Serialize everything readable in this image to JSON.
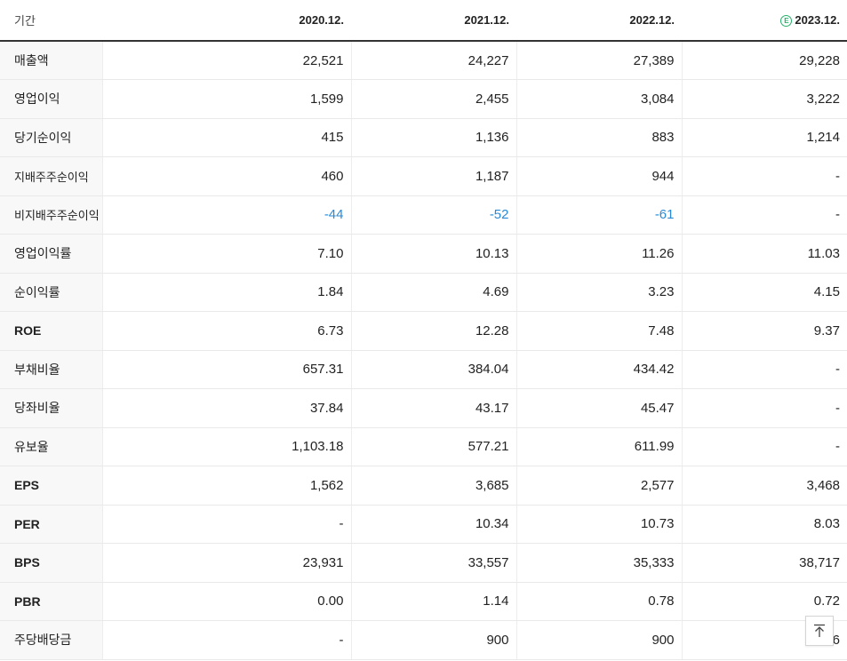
{
  "table": {
    "label_header": "기간",
    "periods": [
      {
        "label": "2020.12.",
        "estimate": false
      },
      {
        "label": "2021.12.",
        "estimate": false
      },
      {
        "label": "2022.12.",
        "estimate": false
      },
      {
        "label": "2023.12.",
        "estimate": true,
        "badge": "E"
      }
    ],
    "rows": [
      {
        "label": "매출액",
        "values": [
          "22,521",
          "24,227",
          "27,389",
          "29,228"
        ],
        "group_start": false,
        "style": "normal"
      },
      {
        "label": "영업이익",
        "values": [
          "1,599",
          "2,455",
          "3,084",
          "3,222"
        ],
        "group_start": false,
        "style": "normal"
      },
      {
        "label": "당기순이익",
        "values": [
          "415",
          "1,136",
          "883",
          "1,214"
        ],
        "group_start": false,
        "style": "normal"
      },
      {
        "label": "지배주주순이익",
        "values": [
          "460",
          "1,187",
          "944",
          "-"
        ],
        "group_start": false,
        "style": "small"
      },
      {
        "label": "비지배주주순이익",
        "values": [
          "-44",
          "-52",
          "-61",
          "-"
        ],
        "group_start": false,
        "style": "small"
      },
      {
        "label": "영업이익률",
        "values": [
          "7.10",
          "10.13",
          "11.26",
          "11.03"
        ],
        "group_start": true,
        "style": "normal"
      },
      {
        "label": "순이익률",
        "values": [
          "1.84",
          "4.69",
          "3.23",
          "4.15"
        ],
        "group_start": false,
        "style": "normal"
      },
      {
        "label": "ROE",
        "values": [
          "6.73",
          "12.28",
          "7.48",
          "9.37"
        ],
        "group_start": false,
        "style": "bold"
      },
      {
        "label": "부채비율",
        "values": [
          "657.31",
          "384.04",
          "434.42",
          "-"
        ],
        "group_start": true,
        "style": "normal"
      },
      {
        "label": "당좌비율",
        "values": [
          "37.84",
          "43.17",
          "45.47",
          "-"
        ],
        "group_start": false,
        "style": "normal"
      },
      {
        "label": "유보율",
        "values": [
          "1,103.18",
          "577.21",
          "611.99",
          "-"
        ],
        "group_start": false,
        "style": "normal"
      },
      {
        "label": "EPS",
        "values": [
          "1,562",
          "3,685",
          "2,577",
          "3,468"
        ],
        "group_start": true,
        "style": "bold"
      },
      {
        "label": "PER",
        "values": [
          "-",
          "10.34",
          "10.73",
          "8.03"
        ],
        "group_start": false,
        "style": "bold"
      },
      {
        "label": "BPS",
        "values": [
          "23,931",
          "33,557",
          "35,333",
          "38,717"
        ],
        "group_start": false,
        "style": "bold"
      },
      {
        "label": "PBR",
        "values": [
          "0.00",
          "1.14",
          "0.78",
          "0.72"
        ],
        "group_start": false,
        "style": "bold"
      },
      {
        "label": "주당배당금",
        "values": [
          "-",
          "900",
          "900",
          "6"
        ],
        "group_start": true,
        "style": "normal"
      }
    ]
  },
  "colors": {
    "negative": "#2a8ad6",
    "estimate_badge": "#26b26b",
    "label_background": "#f8f8f8"
  },
  "scroll_top_button": {
    "icon": "arrow-up-icon"
  }
}
